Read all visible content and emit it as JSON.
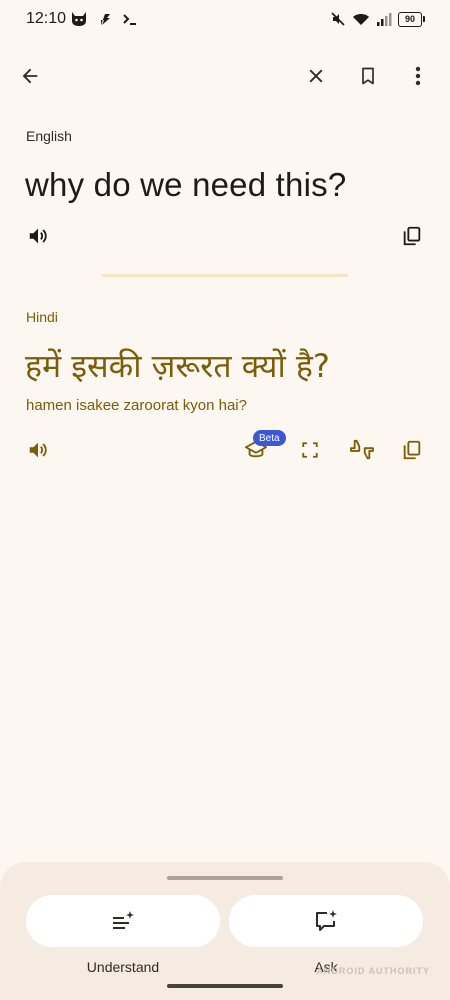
{
  "status": {
    "time": "12:10",
    "battery": "90"
  },
  "icons": {
    "back": "arrow-back-icon",
    "close": "close-icon",
    "save": "bookmark-icon",
    "more": "more-vert-icon",
    "speak": "volume-icon",
    "copy": "copy-icon",
    "learn": "school-icon",
    "fullscreen": "fullscreen-icon",
    "feedback": "thumbs-feedback-icon",
    "understand": "sparkle-list-icon",
    "ask": "sparkle-chat-icon"
  },
  "source": {
    "language": "English",
    "text": "why do we need this?"
  },
  "target": {
    "language": "Hindi",
    "text": "हमें इसकी ज़रूरत क्यों है?",
    "transliteration": "hamen isakee zaroorat kyon hai?",
    "beta_label": "Beta"
  },
  "actions": {
    "understand_label": "Understand",
    "ask_label": "Ask"
  },
  "watermark": "ANDROID AUTHORITY",
  "colors": {
    "background": "#fdf7f2",
    "accent_text": "#7b5c08",
    "sheet": "#f6ebe0",
    "beta": "#3a57d8"
  }
}
